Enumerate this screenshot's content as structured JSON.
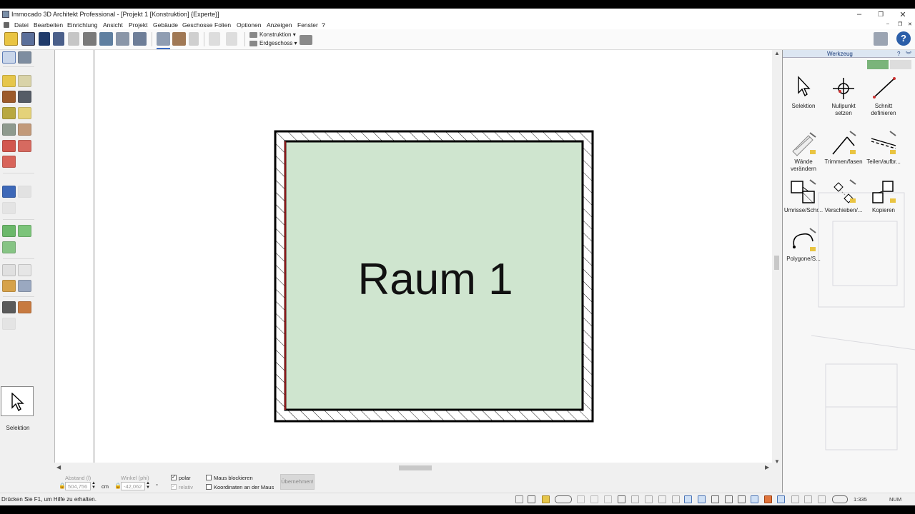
{
  "window": {
    "title": "Immocado 3D Architekt Professional - [Projekt 1 [Konstruktion] {Experte}]",
    "controls": {
      "minimize": "–",
      "restore": "❐",
      "close": "✕"
    }
  },
  "menu": {
    "items": [
      "Datei",
      "Bearbeiten",
      "Einrichtung",
      "Ansicht",
      "Projekt",
      "Gebäude",
      "Geschosse",
      "Folien",
      "Optionen",
      "Anzeigen",
      "Fenster",
      "?"
    ],
    "mdi_controls": {
      "minimize": "–",
      "restore": "❐",
      "close": "✕"
    }
  },
  "toolbar": {
    "view_mode": "Konstruktion",
    "floor": "Erdgeschoss"
  },
  "left_tools": {
    "current_tool_label": "Selektion"
  },
  "drawing": {
    "room_label": "Raum 1",
    "room_fill": "#cfe5cf",
    "wall_color": "#000000",
    "selected_edge_color": "#8b1a1a"
  },
  "panel": {
    "title": "Werkzeug",
    "help": "?",
    "tools": [
      {
        "id": "selektion",
        "label": "Selektion"
      },
      {
        "id": "nullpunkt",
        "label": "Nullpunkt setzen"
      },
      {
        "id": "schnitt",
        "label": "Schnitt definieren"
      },
      {
        "id": "waende",
        "label": "Wände verändern"
      },
      {
        "id": "trimmen",
        "label": "Trimmen/fasen"
      },
      {
        "id": "teilen",
        "label": "Teilen/aufbr..."
      },
      {
        "id": "umrisse",
        "label": "Umrisse/Schr..."
      },
      {
        "id": "verschieben",
        "label": "Verschieben/..."
      },
      {
        "id": "kopieren",
        "label": "Kopieren"
      },
      {
        "id": "polygone",
        "label": "Polygone/S..."
      }
    ]
  },
  "input_bar": {
    "distance_label": "Abstand (l)",
    "distance_value": "504,756",
    "distance_unit": "cm",
    "angle_label": "Winkel (phi)",
    "angle_value": "-42,062",
    "angle_unit": "°",
    "polar_label": "polar",
    "relative_label": "relativ",
    "lock_mouse_label": "Maus blockieren",
    "coords_label": "Koordinaten an der Maus",
    "apply_label": "Übernehmen!"
  },
  "statusbar": {
    "hint": "Drücken Sie F1, um Hilfe zu erhalten.",
    "scale": "1:335",
    "num": "NUM"
  }
}
